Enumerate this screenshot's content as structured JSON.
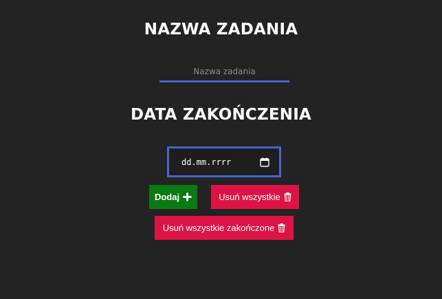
{
  "form": {
    "title_heading": "NAZWA ZADANIA",
    "task_placeholder": "Nazwa zadania",
    "date_heading": "DATA ZAKOŃCZENIA",
    "date_placeholder": "dd.mm.rrrr"
  },
  "buttons": {
    "add_label": "Dodaj",
    "remove_all_label": "Usuń wszystkie",
    "remove_completed_label": "Usuń wszystkie zakończone"
  },
  "icons": {
    "add": "plus-icon",
    "remove_all": "trash-icon",
    "remove_completed": "trash-icon",
    "date": "calendar-icon"
  },
  "colors": {
    "background": "#232323",
    "input_accent": "#4466cc",
    "add_button": "#0b7a12",
    "danger_button": "#dc1446"
  }
}
